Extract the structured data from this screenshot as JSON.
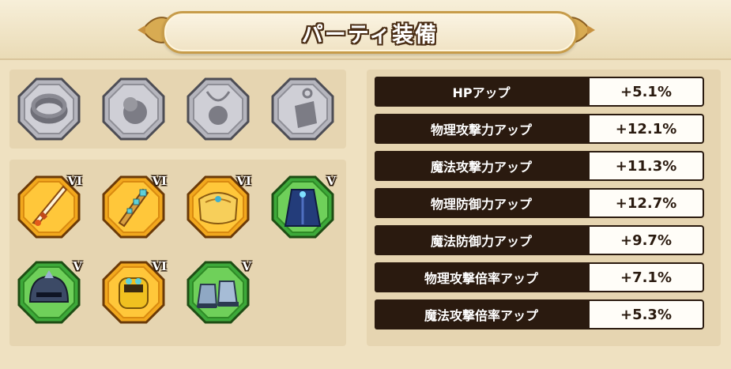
{
  "header": {
    "title": "パーティ装備"
  },
  "locked_slots": [
    {
      "icon": "ring-silhouette-icon"
    },
    {
      "icon": "orb-silhouette-icon"
    },
    {
      "icon": "necklace-silhouette-icon"
    },
    {
      "icon": "charm-silhouette-icon"
    }
  ],
  "equipment": [
    {
      "icon": "sword-icon",
      "rank": "VI",
      "frame": "gold"
    },
    {
      "icon": "staff-icon",
      "rank": "VI",
      "frame": "gold"
    },
    {
      "icon": "armor-icon",
      "rank": "VI",
      "frame": "gold"
    },
    {
      "icon": "robe-icon",
      "rank": "V",
      "frame": "green"
    },
    {
      "icon": "helmet-icon",
      "rank": "V",
      "frame": "green"
    },
    {
      "icon": "gauntlet-icon",
      "rank": "VI",
      "frame": "gold"
    },
    {
      "icon": "boots-icon",
      "rank": "V",
      "frame": "green"
    }
  ],
  "stats": [
    {
      "label": "HPアップ",
      "value": "+5.1%"
    },
    {
      "label": "物理攻撃力アップ",
      "value": "+12.1%"
    },
    {
      "label": "魔法攻撃力アップ",
      "value": "+11.3%"
    },
    {
      "label": "物理防御力アップ",
      "value": "+12.7%"
    },
    {
      "label": "魔法防御力アップ",
      "value": "+9.7%"
    },
    {
      "label": "物理攻撃倍率アップ",
      "value": "+7.1%"
    },
    {
      "label": "魔法攻撃倍率アップ",
      "value": "+5.3%"
    }
  ],
  "colors": {
    "gold_frame": "#f2a81e",
    "green_frame": "#3da93a",
    "locked_frame": "#9a9aa2",
    "label_bg": "#2a1a0f"
  }
}
